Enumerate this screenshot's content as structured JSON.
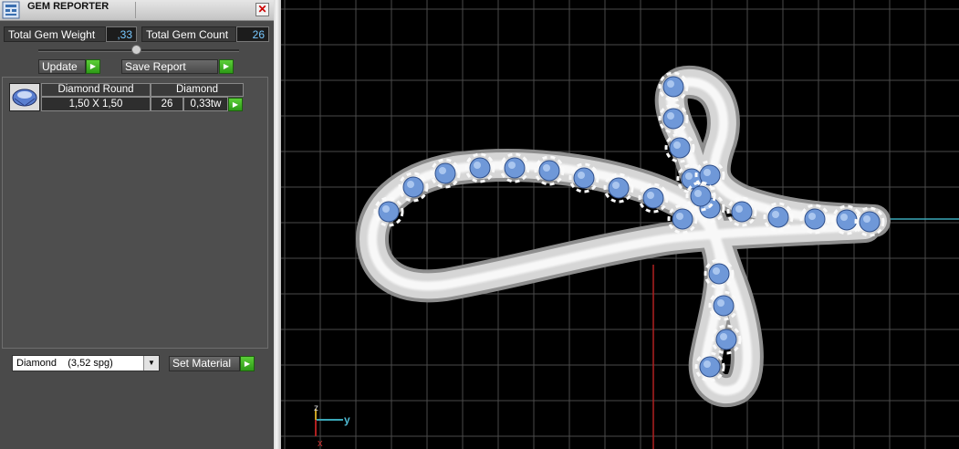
{
  "panel": {
    "title": "GEM REPORTER",
    "close_glyph": "✕",
    "app_icon": "gem-reporter-icon",
    "total_weight_label": "Total Gem Weight",
    "total_weight_value": ",33",
    "total_count_label": "Total Gem Count",
    "total_count_value": "26",
    "update_label": "Update",
    "save_label": "Save Report",
    "go_glyph": "▶"
  },
  "gem_list": {
    "rows": [
      {
        "shape_header": "Diamond Round",
        "material_header": "Diamond",
        "size": "1,50 X 1,50",
        "count": "26",
        "weight": "0,33tw",
        "icon": "diamond-round-icon"
      }
    ]
  },
  "material": {
    "selected": "Diamond    (3,52 spg)",
    "set_label": "Set Material"
  },
  "viewport": {
    "axis_z": "z",
    "axis_y": "y",
    "axis_x": "x",
    "gem_color": "#6f98d8",
    "metal_color": "#e8e8e8",
    "grid_color": "#4a4a4a"
  }
}
